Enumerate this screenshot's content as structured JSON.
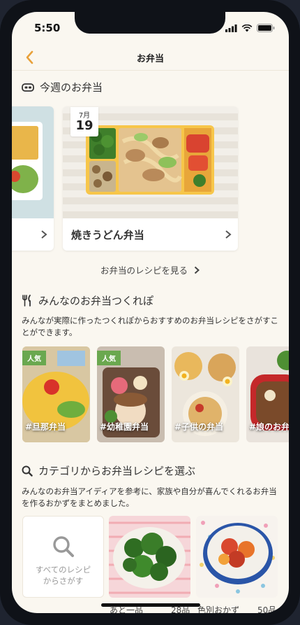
{
  "status": {
    "time": "5:50"
  },
  "nav": {
    "title": "お弁当"
  },
  "weekly": {
    "heading": "今週のお弁当",
    "card": {
      "month": "7月",
      "day": "19",
      "title": "焼きうどん弁当"
    },
    "link": "お弁当のレシピを見る"
  },
  "reports": {
    "heading": "みんなのお弁当つくれぽ",
    "description": "みんなが実際に作ったつくれぽからおすすめのお弁当レシピをさがすことができます。",
    "tiles": [
      {
        "badge": "人気",
        "tag": "#旦那弁当"
      },
      {
        "badge": "人気",
        "tag": "#幼稚園弁当"
      },
      {
        "badge": "",
        "tag": "#子供の弁当"
      },
      {
        "badge": "",
        "tag": "#娘のお弁"
      }
    ]
  },
  "category": {
    "heading": "カテゴリからお弁当レシピを選ぶ",
    "description": "みんなのお弁当アイディアを参考に、家族や自分が喜んでくれるお弁当を作るおかずをまとめました。",
    "search_tile": {
      "line1": "すべてのレシピ",
      "line2": "からさがす"
    },
    "bottom": [
      "あと一品",
      "28品",
      "色別おかず",
      "50品"
    ]
  },
  "colors": {
    "accent": "#e8a13a",
    "badge_green": "#6aa84f",
    "background": "#faf7f0"
  }
}
